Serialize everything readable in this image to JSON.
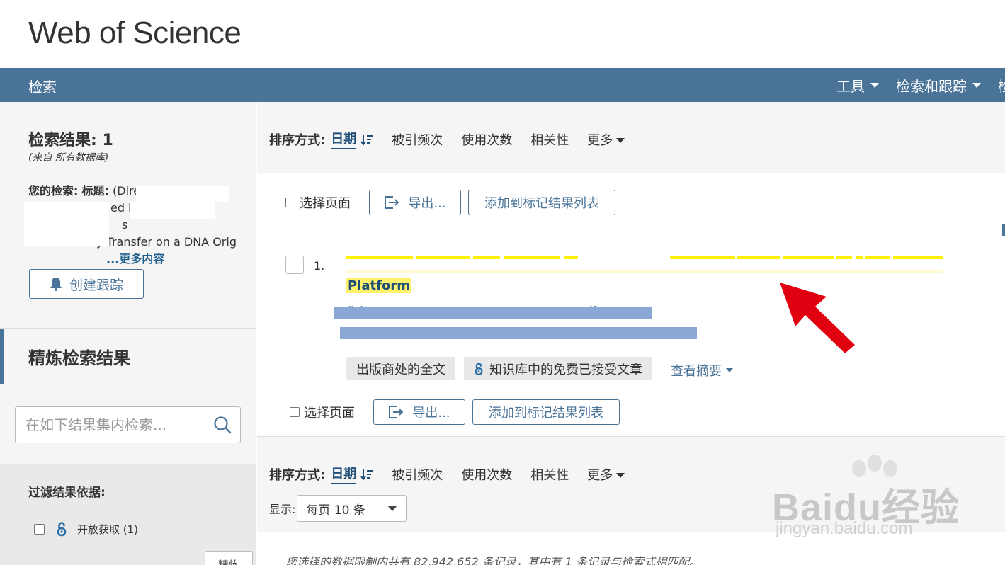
{
  "app": {
    "title": "Web of Science"
  },
  "nav": {
    "search": "检索",
    "tools": "工具",
    "search_tracking": "检索和跟踪",
    "cut_item": "检"
  },
  "sidebar": {
    "results_label": "检索结果:",
    "results_count": "1",
    "source": "(来自 所有数据库)",
    "your_search_label": "您的检索:",
    "title_label": "标题:",
    "query_fragments": [
      "(Directional Photo",
      "ed by",
      "s",
      "y Transfer on a DNA Orig"
    ],
    "more_link": "...更多内容",
    "create_alert": "创建跟踪",
    "refine_title": "精炼检索结果",
    "search_placeholder": "在如下结果集内检索...",
    "filter_title": "过滤结果依据:",
    "open_access": "开放获取 (1)",
    "refine_button": "精炼"
  },
  "sort": {
    "label": "排序方式:",
    "active": "日期",
    "options": [
      "被引频次",
      "使用次数",
      "相关性"
    ],
    "more": "更多"
  },
  "toolbar": {
    "select_page": "选择页面",
    "export": "导出...",
    "add_to_marked": "添加到标记结果列表"
  },
  "record": {
    "number": "1.",
    "title_tail": "Platform",
    "authors": "作者: Nieli Fe...... Both A... ... Re... W... li 等"
  },
  "links": {
    "publisher_fulltext": "出版商处的全文",
    "free_accepted": "知识库中的免费已接受文章",
    "view_abstract": "查看摘要"
  },
  "footer": {
    "show_label": "显示:",
    "per_page": "每页 10 条",
    "summary": "您选择的数据限制内共有 82,942,652 条记录，其中有 1 条记录与检索式相匹配。"
  },
  "watermark": {
    "brand": "Bai",
    "brand2": "du",
    "cn": "经验",
    "url": "jingyan.baidu.com"
  },
  "colors": {
    "nav": "#4a7398",
    "link": "#1f4e79",
    "highlight": "#fff200",
    "arrow": "#e10010"
  }
}
